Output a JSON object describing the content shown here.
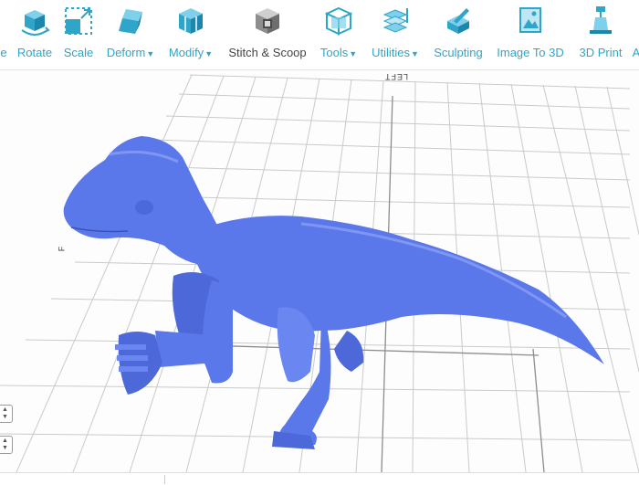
{
  "toolbar": {
    "tools": [
      {
        "label": "e",
        "dropdown": false,
        "icon": "cut-icon"
      },
      {
        "label": "Rotate",
        "dropdown": false,
        "icon": "rotate-icon"
      },
      {
        "label": "Scale",
        "dropdown": false,
        "icon": "scale-icon"
      },
      {
        "label": "Deform",
        "dropdown": true,
        "icon": "deform-icon"
      },
      {
        "label": "Modify",
        "dropdown": true,
        "icon": "modify-icon"
      },
      {
        "label": "Stitch & Scoop",
        "dropdown": false,
        "icon": "stitch-scoop-icon"
      },
      {
        "label": "Tools",
        "dropdown": true,
        "icon": "tools-icon"
      },
      {
        "label": "Utilities",
        "dropdown": true,
        "icon": "utilities-icon"
      },
      {
        "label": "Sculpting",
        "dropdown": false,
        "icon": "sculpting-icon"
      },
      {
        "label": "Image To 3D",
        "dropdown": false,
        "icon": "image-to-3d-icon"
      },
      {
        "label": "3D Print",
        "dropdown": false,
        "icon": "3d-print-icon"
      },
      {
        "label": "A",
        "dropdown": false,
        "icon": "more-icon"
      }
    ]
  },
  "viewport": {
    "axis_left_label": "LEFT",
    "axis_front_label": "F",
    "model_color": "#5b78ea",
    "grid_color": "#c9c9c9"
  },
  "colors": {
    "accent": "#2ea5c9",
    "active_label": "#444444"
  }
}
